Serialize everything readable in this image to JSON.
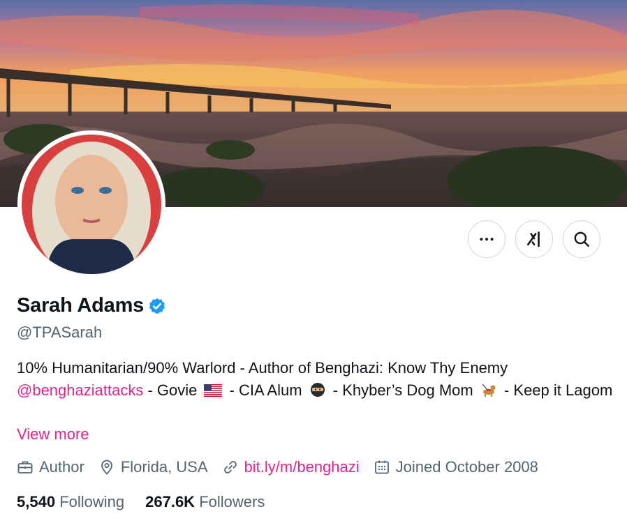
{
  "profile": {
    "display_name": "Sarah Adams",
    "handle": "@TPASarah",
    "verified": true
  },
  "header_actions": {
    "more_label": "···",
    "grok_label": "Grok",
    "search_label": "Search"
  },
  "bio": {
    "line1": "10% Humanitarian/90% Warlord - Author of Benghazi: Know Thy Enemy",
    "mention": "@benghaziattacks",
    "seg_govie": " - Govie",
    "seg_cia": " - CIA Alum",
    "seg_dog": " - Khyber’s Dog Mom",
    "seg_keep": " - Keep it Lagom",
    "view_more": "View more"
  },
  "meta": {
    "profession": "Author",
    "location": "Florida, USA",
    "link": "bit.ly/m/benghazi",
    "joined": "Joined October 2008"
  },
  "stats": {
    "following_count": "5,540",
    "following_label": "Following",
    "followers_count": "267.6K",
    "followers_label": "Followers"
  },
  "icons": {
    "more": "more-icon",
    "grok": "grok-icon",
    "search": "search-icon",
    "verified": "verified-badge-icon",
    "briefcase": "briefcase-icon",
    "location": "location-pin-icon",
    "link": "link-icon",
    "calendar": "calendar-icon"
  },
  "colors": {
    "accent": "#e0248c",
    "verified": "#1d9bf0",
    "secondary_text": "#536471"
  }
}
